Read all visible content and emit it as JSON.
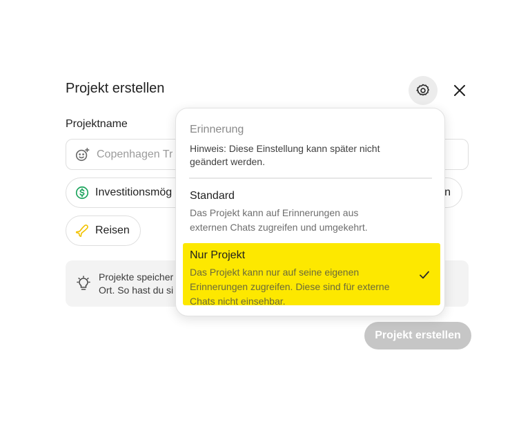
{
  "dialog": {
    "title": "Projekt erstellen",
    "name_label": "Projektname",
    "name_placeholder": "Copenhagen Tr",
    "chips": [
      {
        "label": "Investitionsmög",
        "icon": "dollar-circle-icon"
      },
      {
        "label": "n",
        "icon": ""
      },
      {
        "label": "Reisen",
        "icon": "airplane-icon"
      }
    ],
    "info_lines": [
      "Projekte speicher",
      "Ort. So hast du si"
    ],
    "create_button": "Projekt erstellen"
  },
  "popover": {
    "heading": "Erinnerung",
    "hint": "Hinweis: Diese Einstellung kann später nicht geändert werden.",
    "options": [
      {
        "title": "Standard",
        "description": "Das Projekt kann auf Erinnerungen aus externen Chats zugreifen und umgekehrt.",
        "selected": false
      },
      {
        "title": "Nur Projekt",
        "description": "Das Projekt kann nur auf seine eigenen Erinnerungen zugreifen. Diese sind für externe Chats nicht einsehbar.",
        "selected": true
      }
    ]
  },
  "colors": {
    "highlight": "#fde800",
    "dollar_icon": "#1aa35b",
    "airplane_icon": "#f2c200",
    "button_disabled": "#c6c6c6"
  }
}
